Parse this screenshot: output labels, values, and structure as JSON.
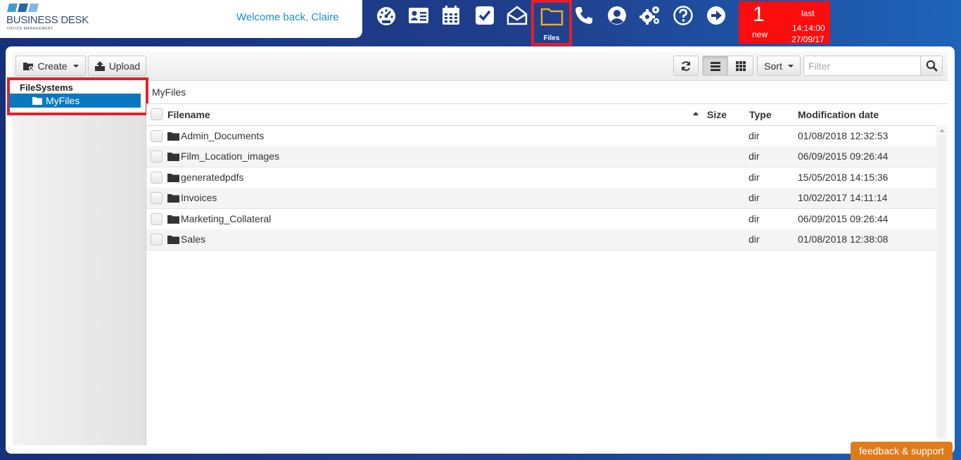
{
  "header": {
    "logo_title": "BUSINESS DESK",
    "logo_subtitle": "OFFICE MANAGEMENT",
    "welcome": "Welcome back, Claire"
  },
  "nav": {
    "items": [
      {
        "name": "dashboard",
        "icon": "speedometer-icon"
      },
      {
        "name": "contacts",
        "icon": "contact-card-icon"
      },
      {
        "name": "calendar",
        "icon": "calendar-icon"
      },
      {
        "name": "tasks",
        "icon": "checkbox-icon"
      },
      {
        "name": "mail",
        "icon": "envelope-open-icon"
      },
      {
        "name": "files",
        "icon": "folder-icon",
        "label": "Files",
        "active": true
      },
      {
        "name": "calls",
        "icon": "phone-icon"
      },
      {
        "name": "profile",
        "icon": "user-circle-icon"
      },
      {
        "name": "settings",
        "icon": "gears-icon"
      },
      {
        "name": "help",
        "icon": "question-circle-icon"
      },
      {
        "name": "logout",
        "icon": "arrow-right-circle-icon"
      }
    ],
    "files_label": "Files",
    "active_color": "#f5a623"
  },
  "notifications": {
    "count": "1",
    "new_label": "new",
    "last_label": "last",
    "time": "14:14:00",
    "date": "27/09/17",
    "color": "#fb0d0d"
  },
  "toolbar": {
    "create_label": "Create",
    "upload_label": "Upload",
    "sort_label": "Sort",
    "filter_placeholder": "Filter",
    "filter_value": ""
  },
  "sidebar": {
    "title": "FileSystems",
    "items": [
      {
        "label": "MyFiles",
        "selected": true
      }
    ]
  },
  "breadcrumb": "MyFiles",
  "table": {
    "columns": {
      "filename": "Filename",
      "size": "Size",
      "type": "Type",
      "modified": "Modification date"
    },
    "rows": [
      {
        "name": "Admin_Documents",
        "size": "",
        "type": "dir",
        "modified": "01/08/2018 12:32:53"
      },
      {
        "name": "Film_Location_images",
        "size": "",
        "type": "dir",
        "modified": "06/09/2015 09:26:44"
      },
      {
        "name": "generatedpdfs",
        "size": "",
        "type": "dir",
        "modified": "15/05/2018 14:15:36"
      },
      {
        "name": "Invoices",
        "size": "",
        "type": "dir",
        "modified": "10/02/2017 14:11:14"
      },
      {
        "name": "Marketing_Collateral",
        "size": "",
        "type": "dir",
        "modified": "06/09/2015 09:26:44"
      },
      {
        "name": "Sales",
        "size": "",
        "type": "dir",
        "modified": "01/08/2018 12:38:08"
      }
    ]
  },
  "feedback_label": "feedback & support"
}
